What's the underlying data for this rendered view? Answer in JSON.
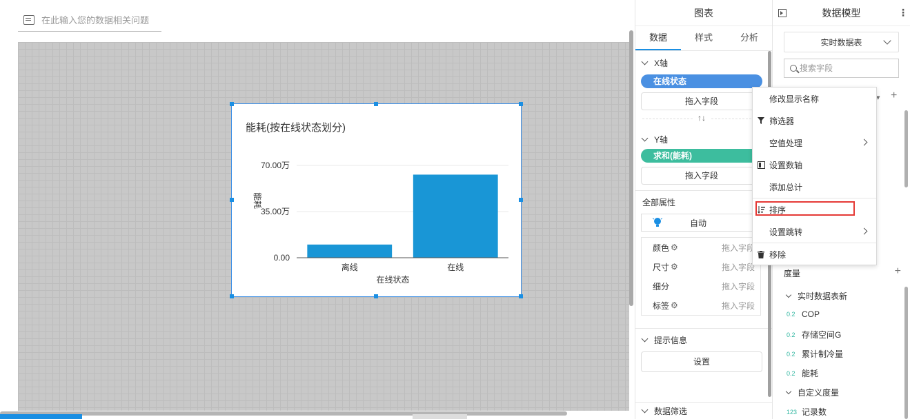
{
  "ask": {
    "placeholder": "在此输入您的数据相关问题"
  },
  "chart_widget": {
    "title": "能耗(按在线状态划分)"
  },
  "chart_data": {
    "type": "bar",
    "title": "能耗(按在线状态划分)",
    "xlabel": "在线状态",
    "ylabel": "能耗",
    "categories": [
      "离线",
      "在线"
    ],
    "values": [
      100000,
      630000
    ],
    "ylim": [
      0,
      700000
    ],
    "yticks": [
      {
        "value": 0,
        "label": "0.00"
      },
      {
        "value": 350000,
        "label": "35.00万"
      },
      {
        "value": 700000,
        "label": "70.00万"
      }
    ],
    "colors": {
      "bar": "#1996d6",
      "grid": "#e8e8e8",
      "axis": "#555555"
    },
    "grid": true,
    "legend": "none"
  },
  "mid": {
    "title": "图表",
    "tabs": [
      "数据",
      "样式",
      "分析"
    ],
    "x_axis": {
      "label": "X轴",
      "pill": "在线状态",
      "pill_color": "#4a90e2",
      "drop": "拖入字段"
    },
    "swap_icon": "↑↓",
    "y_axis": {
      "label": "Y轴",
      "pill": "求和(能耗)",
      "pill_color": "#3dbd9e",
      "drop": "拖入字段"
    },
    "all_props": {
      "label": "全部属性",
      "auto": "自动",
      "rows": [
        {
          "name": "颜色",
          "gear": true,
          "placeholder": "拖入字段"
        },
        {
          "name": "尺寸",
          "gear": true,
          "placeholder": "拖入字段"
        },
        {
          "name": "细分",
          "gear": false,
          "placeholder": "拖入字段"
        },
        {
          "name": "标签",
          "gear": true,
          "placeholder": "拖入字段"
        }
      ]
    },
    "tip": {
      "label": "提示信息",
      "button": "设置"
    },
    "filter": {
      "label": "数据筛选"
    }
  },
  "right": {
    "title": "数据模型",
    "table_select": "实时数据表",
    "search_placeholder": "搜索字段",
    "measure_label": "度量",
    "groups": [
      {
        "name": "实时数据表新",
        "fields": [
          {
            "type": "0.2",
            "name": "COP"
          },
          {
            "type": "0.2",
            "name": "存储空间G"
          },
          {
            "type": "0.2",
            "name": "累计制冷量"
          },
          {
            "type": "0.2",
            "name": "能耗"
          }
        ]
      },
      {
        "name": "自定义度量",
        "fields": [
          {
            "type": "123",
            "name": "记录数"
          }
        ]
      }
    ]
  },
  "context_menu": {
    "items": [
      {
        "label": "修改显示名称",
        "icon": ""
      },
      {
        "label": "筛选器",
        "icon": "filter-icon"
      },
      {
        "label": "空值处理",
        "icon": "",
        "submenu": true
      },
      {
        "label": "设置数轴",
        "icon": "axis-icon"
      },
      {
        "label": "添加总计",
        "icon": ""
      },
      {
        "label": "排序",
        "icon": "sort-icon"
      },
      {
        "label": "设置跳转",
        "icon": "",
        "submenu": true
      },
      {
        "label": "移除",
        "icon": "trash-icon"
      }
    ],
    "highlight_color": "#e53935"
  }
}
